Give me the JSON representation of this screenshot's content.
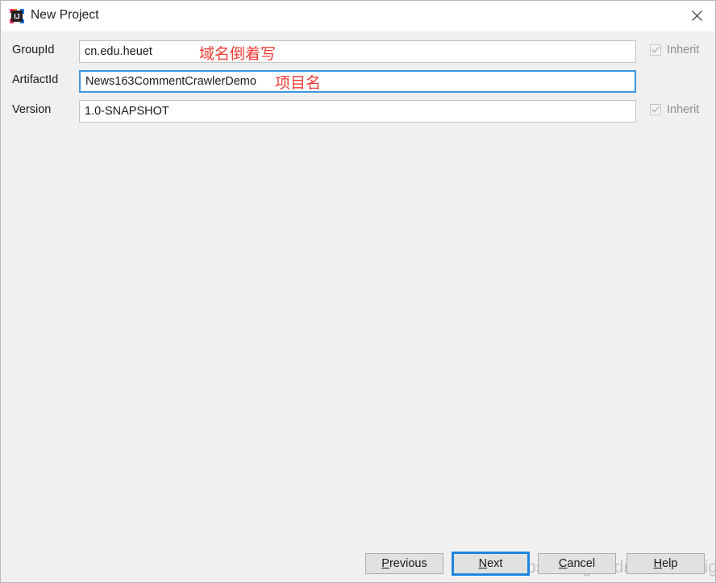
{
  "window": {
    "title": "New Project",
    "app_icon": "intellij-idea-icon",
    "close_icon": "close-icon"
  },
  "form": {
    "rows": [
      {
        "label": "GroupId",
        "value": "cn.edu.heuet",
        "focused": false,
        "inherit_label": "Inherit",
        "inherit_checked": true
      },
      {
        "label": "ArtifactId",
        "value": "News163CommentCrawlerDemo",
        "focused": true,
        "inherit_label": "",
        "inherit_checked": false
      },
      {
        "label": "Version",
        "value": "1.0-SNAPSHOT",
        "focused": false,
        "inherit_label": "Inherit",
        "inherit_checked": true
      }
    ]
  },
  "annotations": {
    "groupid": "域名倒着写",
    "artifactid": "项目名",
    "color": "#ef3b34"
  },
  "buttons": {
    "previous": {
      "prefix": "",
      "mnemonic": "P",
      "suffix": "revious"
    },
    "next": {
      "prefix": "",
      "mnemonic": "N",
      "suffix": "ext"
    },
    "cancel": {
      "prefix": "",
      "mnemonic": "C",
      "suffix": "ancel"
    },
    "help": {
      "prefix": "",
      "mnemonic": "H",
      "suffix": "elp"
    }
  },
  "watermark": {
    "text": "https://blog.csdn.net/midnight_time"
  },
  "colors": {
    "focus_blue": "#1e86e0",
    "panel_gray": "#f0f0f0",
    "button_gray": "#e1e1e1"
  }
}
